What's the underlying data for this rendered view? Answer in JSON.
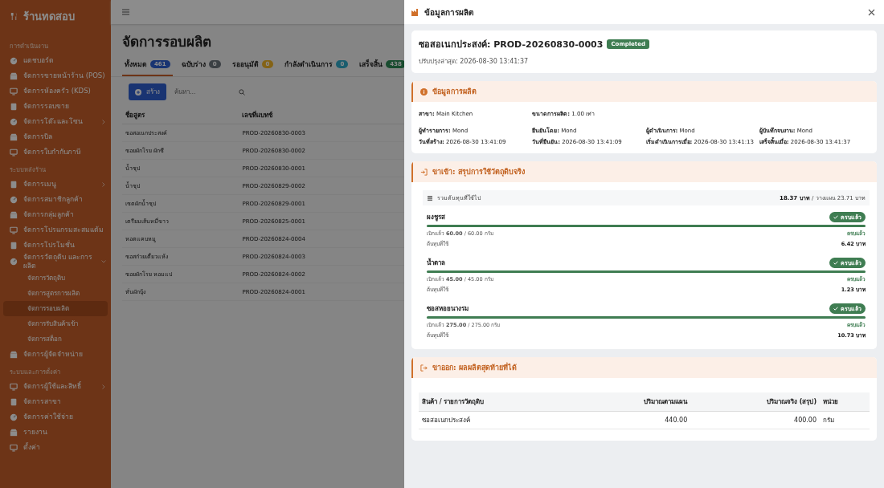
{
  "sidebar": {
    "brand": "ร้านทดสอบ",
    "sections": [
      {
        "title": "การดำเนินงาน",
        "items": [
          {
            "label": "แดชบอร์ด",
            "selected": false
          },
          {
            "label": "จัดการขายหน้าร้าน (POS)",
            "selected": false
          },
          {
            "label": "จัดการห้องครัว (KDS)",
            "selected": false
          },
          {
            "label": "จัดการรอบขาย",
            "selected": false
          },
          {
            "label": "จัดการโต๊ะและโซน",
            "selected": false,
            "expanded": false
          },
          {
            "label": "จัดการบิล",
            "selected": false
          },
          {
            "label": "จัดการใบกำกับภาษี",
            "selected": false
          }
        ]
      },
      {
        "title": "ระบบหลังร้าน",
        "items": [
          {
            "label": "จัดการเมนู",
            "selected": false,
            "expanded": false
          },
          {
            "label": "จัดการสมาชิกลูกค้า",
            "selected": false
          },
          {
            "label": "จัดการกลุ่มลูกค้า",
            "selected": false
          },
          {
            "label": "จัดการโปรแกรมสะสมแต้ม",
            "selected": false
          },
          {
            "label": "จัดการโปรโมชั่น",
            "selected": false
          },
          {
            "label": "จัดการวัตถุดิบ และการผลิต",
            "selected": false,
            "expanded": true,
            "children": [
              {
                "label": "จัดการวัตถุดิบ",
                "selected": false
              },
              {
                "label": "จัดการสูตรการผลิต",
                "selected": false
              },
              {
                "label": "จัดการรอบผลิต",
                "selected": true
              },
              {
                "label": "จัดการรับสินค้าเข้า",
                "selected": false
              },
              {
                "label": "จัดการสต็อก",
                "selected": false
              }
            ]
          },
          {
            "label": "จัดการผู้จัดจำหน่าย",
            "selected": false
          }
        ]
      },
      {
        "title": "ระบบและการตั้งค่า",
        "items": [
          {
            "label": "จัดการผู้ใช้และสิทธิ์",
            "selected": false,
            "expanded": false
          },
          {
            "label": "จัดการสาขา",
            "selected": false
          },
          {
            "label": "จัดการค่าใช้จ่าย",
            "selected": false
          },
          {
            "label": "รายงาน",
            "selected": false
          },
          {
            "label": "ตั้งค่า",
            "selected": false
          }
        ]
      }
    ]
  },
  "main": {
    "title": "จัดการรอบผลิต",
    "tabs": [
      {
        "label": "ทั้งหมด",
        "count": "461",
        "kind": "all",
        "selected": true
      },
      {
        "label": "ฉบับร่าง",
        "count": "0",
        "kind": "draft",
        "selected": false
      },
      {
        "label": "รออนุมัติ",
        "count": "0",
        "kind": "pending",
        "selected": false
      },
      {
        "label": "กำลังดำเนินการ",
        "count": "0",
        "kind": "running",
        "selected": false
      },
      {
        "label": "เสร็จสิ้น",
        "count": "438",
        "kind": "done",
        "selected": false
      }
    ],
    "create_button": "สร้าง",
    "search": {
      "placeholder": "ค้นหา..."
    },
    "table": {
      "columns": [
        "ชื่อสูตร",
        "เลขที่แบทช์"
      ],
      "rows": [
        [
          "ซอสอเนกประสงค์",
          "PROD-20260830-0003"
        ],
        [
          "ซอยผักโรย ผักชี",
          "PROD-20260830-0002"
        ],
        [
          "น้ำซุป",
          "PROD-20260830-0001"
        ],
        [
          "น้ำซุป",
          "PROD-20260829-0002"
        ],
        [
          "เซตผักน้ำซุป",
          "PROD-20260829-0001"
        ],
        [
          "เตรียมเส้นหมี่ขาว",
          "PROD-20260825-0001"
        ],
        [
          "หอตแคบหมู",
          "PROD-20260824-0004"
        ],
        [
          "ซอสก๋วยเตี๋ยวแห้ง",
          "PROD-20260824-0003"
        ],
        [
          "ซอยผักโรย หอมแป",
          "PROD-20260824-0002"
        ],
        [
          "หั่นผักบุ้ง",
          "PROD-20260824-0001"
        ]
      ]
    }
  },
  "drawer": {
    "title": "ข้อมูลการผลิต",
    "header": {
      "name": "ซอสอเนกประสงค์: PROD-20260830-0003",
      "status": "Completed",
      "updated": "ปรับปรุงล่าสุด: 2026-08-30 13:41:37"
    },
    "info": {
      "title": "ข้อมูลการผลิต",
      "summary": [
        {
          "label": "สาขา:",
          "value": "Main Kitchen"
        },
        {
          "label": "ขนาดการผลิต:",
          "value": "1.00 เท่า"
        }
      ],
      "columns": [
        [
          {
            "label": "ผู้ทำรายการ:",
            "value": "Mond"
          },
          {
            "label": "วันที่สร้าง:",
            "value": "2026-08-30 13:41:09"
          }
        ],
        [
          {
            "label": "ยืนยันโดย:",
            "value": "Mond"
          },
          {
            "label": "วันที่ยืนยัน:",
            "value": "2026-08-30 13:41:09"
          }
        ],
        [
          {
            "label": "ผู้ดำเนินการ:",
            "value": "Mond"
          },
          {
            "label": "เริ่มดำเนินการเมื่อ:",
            "value": "2026-08-30 13:41:13"
          }
        ],
        [
          {
            "label": "ผู้บันทึกจบงาน:",
            "value": "Mond"
          },
          {
            "label": "เสร็จสิ้นเมื่อ:",
            "value": "2026-08-30 13:41:37"
          }
        ]
      ]
    },
    "inputs": {
      "title": "ขาเข้า: สรุปการใช้วัตถุดิบจริง",
      "total_label": "รวมต้นทุนที่ใช้ไป",
      "total_value": "18.37 บาท",
      "total_plan": "/ วางแผน 23.71 บาท",
      "materials": [
        {
          "name": "ผงชูรส",
          "complete": true,
          "badge": "ครบแล้ว",
          "level": 1,
          "issued": "เบิกแล้ว **60.00** / 60.00 กรัม",
          "issue_status": "ครบแล้ว",
          "cost_label": "ต้นทุนที่ใช้",
          "cost": "6.42 บาท"
        },
        {
          "name": "น้ำตาล",
          "complete": true,
          "badge": "ครบแล้ว",
          "level": 1,
          "issued": "เบิกแล้ว **45.00** / 45.00 กรัม",
          "issue_status": "ครบแล้ว",
          "cost_label": "ต้นทุนที่ใช้",
          "cost": "1.23 บาท"
        },
        {
          "name": "ซอสหอยนางรม",
          "complete": true,
          "badge": "ครบแล้ว",
          "level": 1,
          "issued": "เบิกแล้ว **275.00** / 275.00 กรัม",
          "issue_status": "ครบแล้ว",
          "cost_label": "ต้นทุนที่ใช้",
          "cost": "10.73 บาท"
        }
      ]
    },
    "outputs": {
      "title": "ขาออก: ผลผลิตสุดท้ายที่ได้",
      "columns": [
        "สินค้า / รายการวัตถุดิบ",
        "ปริมาณตามแผน",
        "ปริมาณจริง (สรุป)",
        "หน่วย"
      ],
      "rows": [
        [
          "ซอสอเนกประสงค์",
          "440.00",
          "400.00",
          "กรัม"
        ]
      ]
    }
  }
}
